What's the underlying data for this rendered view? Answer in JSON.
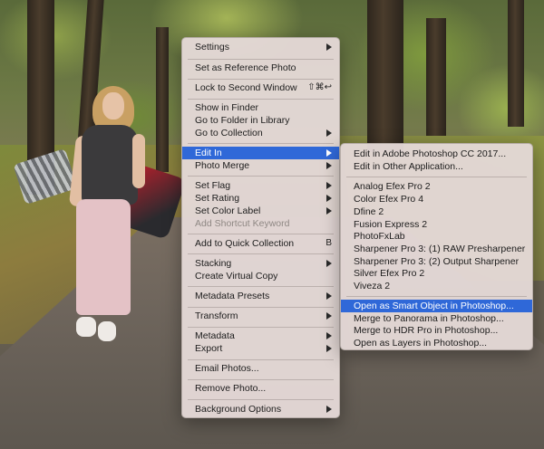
{
  "main_menu": {
    "items": {
      "settings": "Settings",
      "set_reference": "Set as Reference Photo",
      "lock_second_window": "Lock to Second Window",
      "lock_shortcut": "⇧⌘↩",
      "show_in_finder": "Show in Finder",
      "go_folder_library": "Go to Folder in Library",
      "go_collection": "Go to Collection",
      "edit_in": "Edit In",
      "photo_merge": "Photo Merge",
      "set_flag": "Set Flag",
      "set_rating": "Set Rating",
      "set_color_label": "Set Color Label",
      "add_shortcut_keyword": "Add Shortcut Keyword",
      "add_quick_collection": "Add to Quick Collection",
      "quick_collection_shortcut": "B",
      "stacking": "Stacking",
      "create_virtual_copy": "Create Virtual Copy",
      "metadata_presets": "Metadata Presets",
      "transform": "Transform",
      "metadata": "Metadata",
      "export": "Export",
      "email_photos": "Email Photos...",
      "remove_photo": "Remove Photo...",
      "background_options": "Background Options"
    }
  },
  "submenu": {
    "items": {
      "edit_photoshop": "Edit in Adobe Photoshop CC 2017...",
      "edit_other": "Edit in Other Application...",
      "analog_efex": "Analog Efex Pro 2",
      "color_efex": "Color Efex Pro 4",
      "dfine": "Dfine 2",
      "fusion_express": "Fusion Express 2",
      "photofxlab": "PhotoFxLab",
      "sharpener_raw": "Sharpener Pro 3: (1) RAW Presharpener",
      "sharpener_output": "Sharpener Pro 3: (2) Output Sharpener",
      "silver_efex": "Silver Efex Pro 2",
      "viveza": "Viveza 2",
      "open_smart_object": "Open as Smart Object in Photoshop...",
      "merge_panorama": "Merge to Panorama in Photoshop...",
      "merge_hdr": "Merge to HDR Pro in Photoshop...",
      "open_layers": "Open as Layers in Photoshop..."
    }
  },
  "colors": {
    "highlight": "#2f68d8",
    "menu_bg": "#e4d8d6"
  }
}
